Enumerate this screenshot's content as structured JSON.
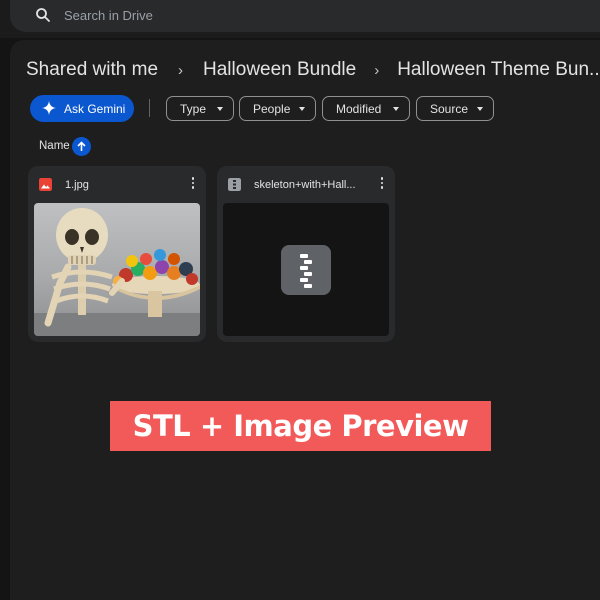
{
  "search": {
    "placeholder": "Search in Drive",
    "icon": "search-icon"
  },
  "breadcrumb": {
    "items": [
      "Shared with me",
      "Halloween Bundle",
      "Halloween Theme Bun..."
    ],
    "separator": "›"
  },
  "filters": {
    "gemini_label": "Ask Gemini",
    "chips": [
      "Type",
      "People",
      "Modified",
      "Source"
    ]
  },
  "sort": {
    "label": "Name",
    "direction": "ascending"
  },
  "files": [
    {
      "name": "1.jpg",
      "type": "image",
      "icon": "image-file-icon",
      "icon_color": "#ea4335"
    },
    {
      "name": "skeleton+with+Hall...",
      "type": "stl",
      "icon": "zip-file-icon",
      "icon_color": "#9aa0a6"
    }
  ],
  "banner": {
    "text": "STL + Image Preview"
  },
  "colors": {
    "accent": "#0b57d0",
    "banner_bg": "#f25a5a",
    "background": "#1e1e1e"
  }
}
